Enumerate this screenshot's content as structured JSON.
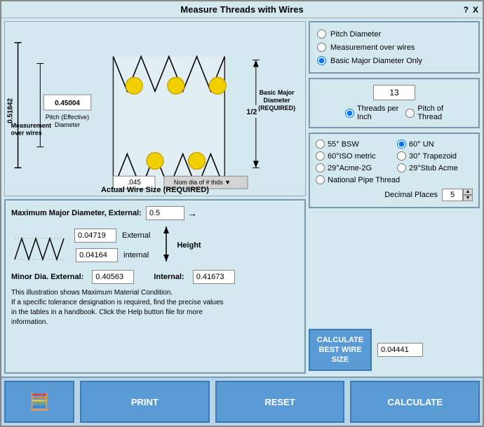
{
  "title": "Measure Threads with Wires",
  "title_controls": {
    "help": "?",
    "close": "X"
  },
  "right_panel": {
    "radio_group": {
      "options": [
        {
          "id": "r1",
          "label": "Pitch Diameter",
          "checked": false
        },
        {
          "id": "r2",
          "label": "Measurement over wires",
          "checked": false
        },
        {
          "id": "r3",
          "label": "Basic Major Diameter Only",
          "checked": true
        }
      ]
    },
    "thread_value": "13",
    "thread_options": [
      {
        "id": "tp",
        "label": "Threads per Inch",
        "checked": true
      },
      {
        "id": "pot",
        "label": "Pitch of Thread",
        "checked": false
      }
    ],
    "angle_options": [
      {
        "id": "a1",
        "label": "55° BSW",
        "checked": false
      },
      {
        "id": "a2",
        "label": "60° UN",
        "checked": true
      },
      {
        "id": "a3",
        "label": "60°ISO metric",
        "checked": false
      },
      {
        "id": "a4",
        "label": "30° Trapezoid",
        "checked": false
      },
      {
        "id": "a5",
        "label": "29°Acme-2G",
        "checked": false
      },
      {
        "id": "a6",
        "label": "29°Stub Acme",
        "checked": false
      },
      {
        "id": "a7",
        "label": "National Pipe Thread",
        "checked": false
      }
    ],
    "decimal_places_label": "Decimal Places",
    "decimal_places_value": "5",
    "calc_best_wire_label": "CALCULATE\nBEST WIRE\nSIZE",
    "calc_result_value": "0.04441"
  },
  "left_panel": {
    "measurement_label": "Measurement\nover wires",
    "measurement_value": "0.51842",
    "pitch_label": "Pitch (Effective)\nDiameter",
    "pitch_value": "0.45004",
    "fraction_value": "1/2",
    "major_diameter_label": "Basic Major\nDiameter\n(REQUIRED)",
    "actual_wire_label": "Actual Wire Size (REQUIRED)",
    "actual_wire_value": ".045",
    "nom_dia_label": "Nom dia of # thds",
    "nom_dia_options": [
      "Nom dia of # thds"
    ],
    "max_major_label": "Maximum Major Diameter, External:",
    "max_major_value": "0.5",
    "external_value": "0.04719",
    "internal_value": "0.04164",
    "external_label": "External",
    "internal_label": "internal",
    "height_label": "Height",
    "minor_ext_label": "Minor Dia. External:",
    "minor_ext_value": "0.40563",
    "minor_int_label": "Internal:",
    "minor_int_value": "0.41673",
    "info_text": "This illustration shows Maximum Material Condition.\nIf a specific tolerance designation is required, find the precise values\nin the tables in a handbook. Click the Help button file for more\ninformation."
  },
  "bottom_bar": {
    "print_label": "PRINT",
    "reset_label": "RESET",
    "calculate_label": "CALCULATE"
  }
}
